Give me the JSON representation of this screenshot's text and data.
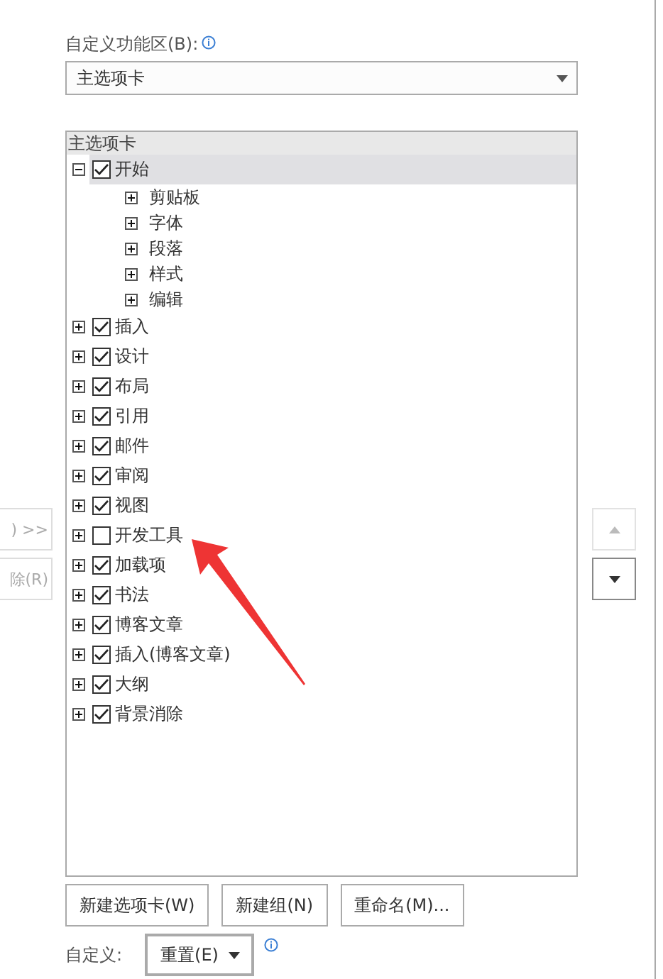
{
  "ribbon_label": "自定义功能区(B):",
  "ribbon_dropdown": {
    "value": "主选项卡"
  },
  "side_buttons": [
    {
      "label": ") >>",
      "disabled": true
    },
    {
      "label": "除(R)",
      "disabled": true
    }
  ],
  "tree": {
    "header": "主选项卡",
    "items": [
      {
        "kind": "tab",
        "label": "开始",
        "checked": true,
        "expanded": true,
        "selected": true,
        "children": [
          {
            "label": "剪贴板",
            "expanded": false
          },
          {
            "label": "字体",
            "expanded": false
          },
          {
            "label": "段落",
            "expanded": false
          },
          {
            "label": "样式",
            "expanded": false
          },
          {
            "label": "编辑",
            "expanded": false
          }
        ]
      },
      {
        "kind": "tab",
        "label": "插入",
        "checked": true,
        "expanded": false,
        "selected": false
      },
      {
        "kind": "tab",
        "label": "设计",
        "checked": true,
        "expanded": false,
        "selected": false
      },
      {
        "kind": "tab",
        "label": "布局",
        "checked": true,
        "expanded": false,
        "selected": false
      },
      {
        "kind": "tab",
        "label": "引用",
        "checked": true,
        "expanded": false,
        "selected": false
      },
      {
        "kind": "tab",
        "label": "邮件",
        "checked": true,
        "expanded": false,
        "selected": false
      },
      {
        "kind": "tab",
        "label": "审阅",
        "checked": true,
        "expanded": false,
        "selected": false
      },
      {
        "kind": "tab",
        "label": "视图",
        "checked": true,
        "expanded": false,
        "selected": false
      },
      {
        "kind": "tab",
        "label": "开发工具",
        "checked": false,
        "expanded": false,
        "selected": false
      },
      {
        "kind": "tab",
        "label": "加载项",
        "checked": true,
        "expanded": false,
        "selected": false
      },
      {
        "kind": "tab",
        "label": "书法",
        "checked": true,
        "expanded": false,
        "selected": false
      },
      {
        "kind": "tab",
        "label": "博客文章",
        "checked": true,
        "expanded": false,
        "selected": false
      },
      {
        "kind": "tab",
        "label": "插入(博客文章)",
        "checked": true,
        "expanded": false,
        "selected": false
      },
      {
        "kind": "tab",
        "label": "大纲",
        "checked": true,
        "expanded": false,
        "selected": false
      },
      {
        "kind": "tab",
        "label": "背景消除",
        "checked": true,
        "expanded": false,
        "selected": false
      }
    ]
  },
  "move_buttons": [
    {
      "kind": "up",
      "disabled": true
    },
    {
      "kind": "down",
      "disabled": false
    }
  ],
  "action_buttons": [
    "新建选项卡(W)",
    "新建组(N)",
    "重命名(M)..."
  ],
  "customize": {
    "label": "自定义:",
    "reset_button": "重置(E)"
  }
}
